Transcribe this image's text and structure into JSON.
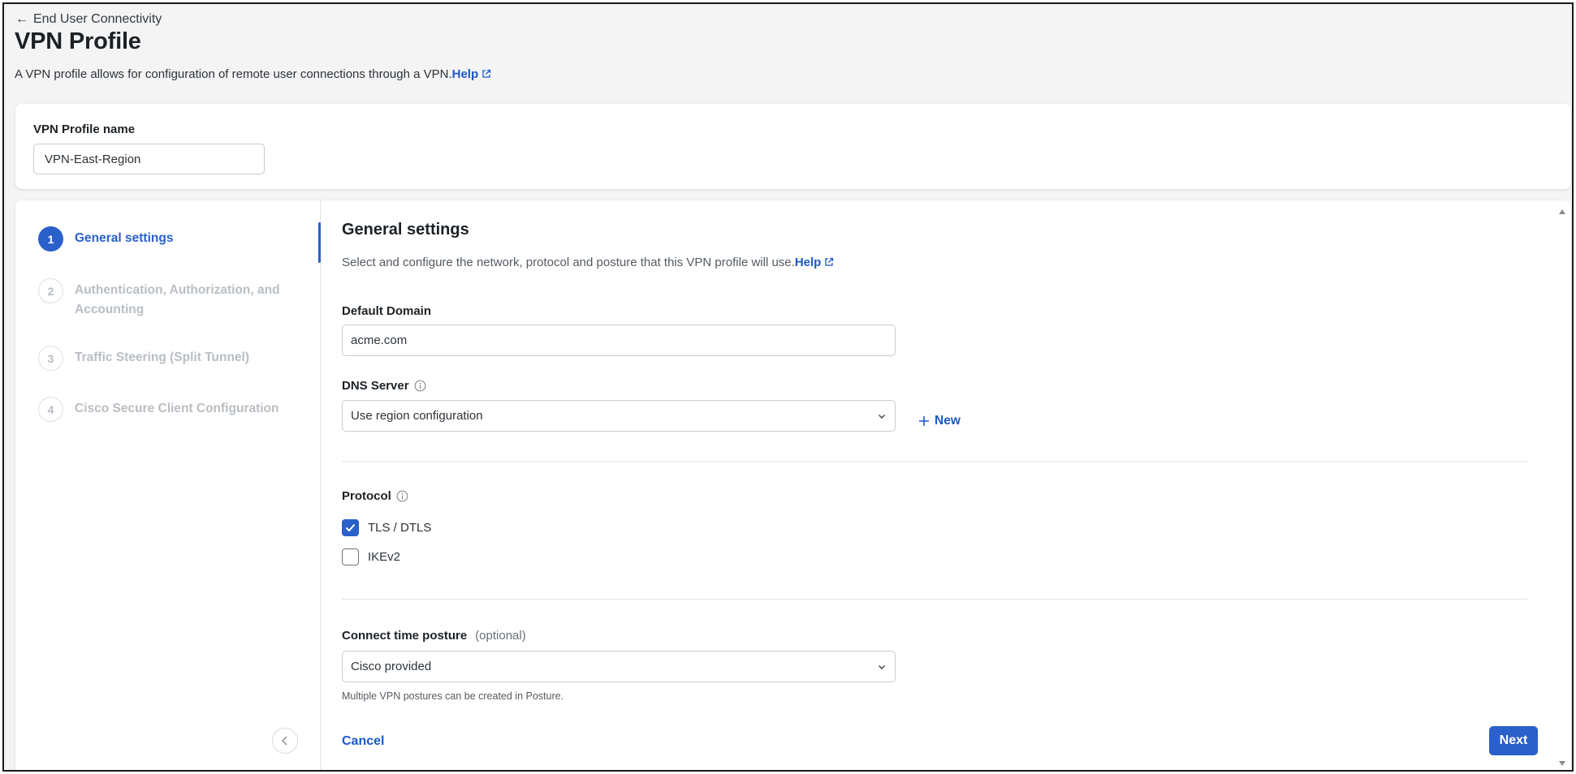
{
  "header": {
    "back_label": "End User Connectivity",
    "title": "VPN Profile",
    "description": "A VPN profile allows for configuration of remote user connections through a VPN.",
    "help_label": "Help"
  },
  "profile_name": {
    "label": "VPN Profile name",
    "value": "VPN-East-Region"
  },
  "stepper": {
    "steps": [
      {
        "number": "1",
        "label": "General settings",
        "state": "active"
      },
      {
        "number": "2",
        "label": "Authentication, Authorization, and Accounting",
        "state": "inactive"
      },
      {
        "number": "3",
        "label": "Traffic Steering (Split Tunnel)",
        "state": "inactive"
      },
      {
        "number": "4",
        "label": "Cisco Secure Client Configuration",
        "state": "inactive"
      }
    ]
  },
  "general": {
    "title": "General settings",
    "description": "Select and configure the network, protocol and posture that this VPN profile will use.",
    "help_label": "Help",
    "default_domain": {
      "label": "Default Domain",
      "value": "acme.com"
    },
    "dns_server": {
      "label": "DNS Server",
      "value": "Use region configuration",
      "new_label": "New"
    },
    "protocol": {
      "label": "Protocol",
      "options": [
        {
          "label": "TLS / DTLS",
          "checked": true
        },
        {
          "label": "IKEv2",
          "checked": false
        }
      ]
    },
    "posture": {
      "label": "Connect time posture",
      "optional_label": "(optional)",
      "value": "Cisco provided",
      "hint": "Multiple VPN postures can be created in Posture."
    }
  },
  "footer": {
    "cancel_label": "Cancel",
    "next_label": "Next"
  },
  "colors": {
    "accent": "#2a60c9",
    "link": "#1d58c6"
  }
}
